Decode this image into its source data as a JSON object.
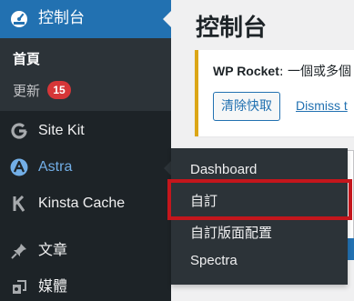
{
  "sidebar": {
    "dashboard_label": "控制台",
    "submenu": {
      "home": "首頁",
      "updates": "更新",
      "updates_count": "15"
    },
    "items": [
      {
        "label": "Site Kit",
        "icon": "google-g-icon"
      },
      {
        "label": "Astra",
        "icon": "astra-icon"
      },
      {
        "label": "Kinsta Cache",
        "icon": "kinsta-k-icon"
      },
      {
        "label": "文章",
        "icon": "pushpin-icon"
      },
      {
        "label": "媒體",
        "icon": "media-icon"
      }
    ]
  },
  "astra_flyout": {
    "items": [
      "Dashboard",
      "自訂",
      "自訂版面配置",
      "Spectra"
    ]
  },
  "main": {
    "title": "控制台",
    "notice": {
      "brand": "WP Rocket",
      "text": ": 一個或多個",
      "clear_cache_button": "清除快取",
      "dismiss_link": "Dismiss t"
    }
  },
  "colors": {
    "sidebar_bg": "#1d2327",
    "active_blue": "#2271b1",
    "hover_text": "#72aee6",
    "badge_red": "#d63638",
    "notice_border": "#dba617",
    "highlight_red": "#c4161c"
  }
}
